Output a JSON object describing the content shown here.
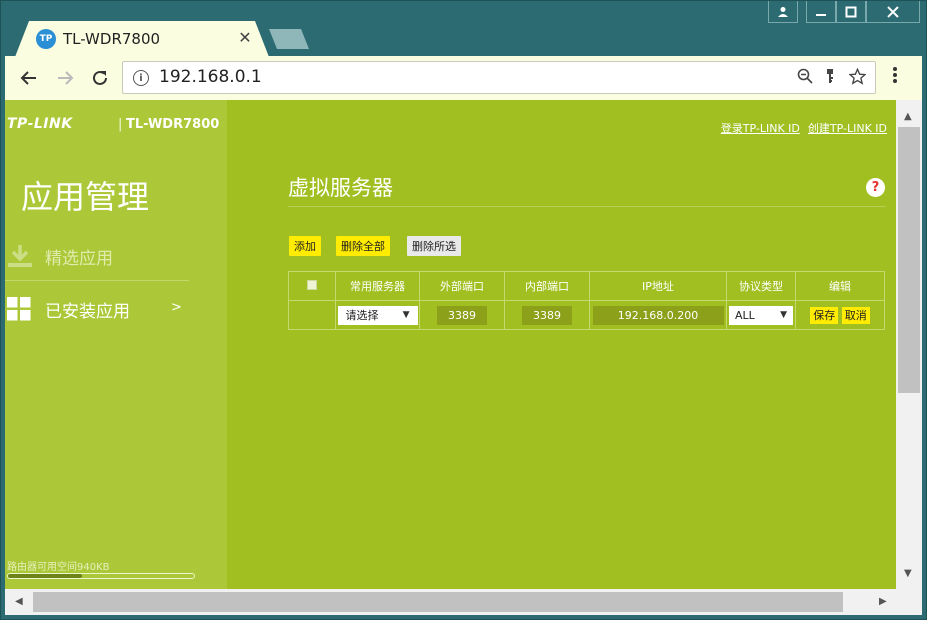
{
  "browser": {
    "tab_title": "TL-WDR7800",
    "tab_favicon_text": "TP",
    "tab_close": "✕",
    "url": "192.168.0.1",
    "window_buttons": [
      "👤",
      "—",
      "☐",
      "✕"
    ],
    "icons": [
      "back-arrow-icon",
      "forward-arrow-icon",
      "reload-icon",
      "info-icon",
      "zoom-icon",
      "key-icon",
      "star-icon",
      "menu-icon"
    ]
  },
  "sidebar": {
    "brand": "TP-LINK",
    "separator": "|",
    "model": "TL-WDR7800",
    "section_title": "应用管理",
    "items": [
      {
        "label": "精选应用",
        "icon": "download-icon",
        "active": false
      },
      {
        "label": "已安装应用",
        "icon": "grid-icon",
        "active": true,
        "arrow": ">"
      }
    ],
    "storage_text": "路由器可用空间940KB",
    "storage_fraction": 0.4
  },
  "main": {
    "top_links": [
      "登录TP-LINK ID",
      "创建TP-LINK ID"
    ],
    "page_title": "虚拟服务器",
    "help_label": "?",
    "buttons": {
      "add": "添加",
      "delete_all": "删除全部",
      "delete_selected": "删除所选"
    },
    "table": {
      "headers": [
        "常用服务器",
        "外部端口",
        "内部端口",
        "IP地址",
        "协议类型",
        "编辑"
      ],
      "row": {
        "server": "请选择",
        "ext_port": "3389",
        "int_port": "3389",
        "ip": "192.168.0.200",
        "protocol": "ALL",
        "save": "保存",
        "cancel": "取消"
      }
    }
  },
  "colors": {
    "accent": "#a2bf22",
    "sidebar": "#acc838",
    "button_yellow": "#ffec00",
    "frame": "#2b6b71"
  }
}
